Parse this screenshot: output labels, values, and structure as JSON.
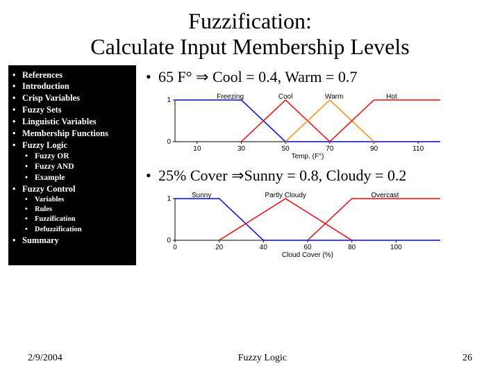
{
  "title_line1": "Fuzzification:",
  "title_line2": "Calculate Input Membership Levels",
  "sidebar": {
    "items": [
      {
        "label": "References"
      },
      {
        "label": "Introduction"
      },
      {
        "label": "Crisp Variables"
      },
      {
        "label": "Fuzzy Sets"
      },
      {
        "label": "Linguistic Variables"
      },
      {
        "label": "Membership Functions"
      },
      {
        "label": "Fuzzy Logic"
      }
    ],
    "sub1": [
      {
        "label": "Fuzzy OR"
      },
      {
        "label": "Fuzzy AND"
      },
      {
        "label": "Example"
      }
    ],
    "fuzzy_control": "Fuzzy Control",
    "sub2": [
      {
        "label": "Variables"
      },
      {
        "label": "Rules"
      },
      {
        "label": "Fuzzification"
      },
      {
        "label": "Defuzzification"
      }
    ],
    "summary": "Summary"
  },
  "main": {
    "bullet_1_pre": "65 F° ",
    "bullet_1_post": " Cool = 0.4, Warm = 0.7",
    "bullet_2_pre": "25% Cover ",
    "bullet_2_post": "Sunny = 0.8, Cloudy = 0.2",
    "arrow": "⇒"
  },
  "footer": {
    "date": "2/9/2004",
    "center": "Fuzzy Logic",
    "page": "26"
  },
  "chart_data": [
    {
      "type": "line",
      "title": "",
      "xlabel": "Temp. (F°)",
      "ylabel": "",
      "xlim": [
        0,
        120
      ],
      "ylim": [
        0,
        1
      ],
      "xticks": [
        10,
        30,
        50,
        70,
        90,
        110
      ],
      "yticks": [
        0,
        1
      ],
      "series": [
        {
          "name": "Freezing",
          "color": "#0000ff",
          "points": [
            [
              0,
              1
            ],
            [
              30,
              1
            ],
            [
              50,
              0
            ],
            [
              120,
              0
            ]
          ]
        },
        {
          "name": "Cool",
          "color": "#ff0000",
          "points": [
            [
              30,
              0
            ],
            [
              50,
              1
            ],
            [
              70,
              0
            ]
          ]
        },
        {
          "name": "Warm",
          "color": "#ff8c00",
          "points": [
            [
              50,
              0
            ],
            [
              70,
              1
            ],
            [
              90,
              0
            ]
          ]
        },
        {
          "name": "Hot",
          "color": "#ff0000",
          "points": [
            [
              70,
              0
            ],
            [
              90,
              1
            ],
            [
              120,
              1
            ]
          ]
        }
      ],
      "label_positions": [
        {
          "name": "Freezing",
          "x": 25
        },
        {
          "name": "Cool",
          "x": 50
        },
        {
          "name": "Warm",
          "x": 72
        },
        {
          "name": "Hot",
          "x": 98
        }
      ]
    },
    {
      "type": "line",
      "title": "",
      "xlabel": "Cloud Cover (%)",
      "ylabel": "",
      "xlim": [
        0,
        120
      ],
      "ylim": [
        0,
        1
      ],
      "xticks": [
        0,
        20,
        40,
        60,
        80,
        100
      ],
      "yticks": [
        0,
        1
      ],
      "series": [
        {
          "name": "Sunny",
          "color": "#0000ff",
          "points": [
            [
              0,
              1
            ],
            [
              20,
              1
            ],
            [
              40,
              0
            ],
            [
              120,
              0
            ]
          ]
        },
        {
          "name": "Partly Cloudy",
          "color": "#ff0000",
          "points": [
            [
              20,
              0
            ],
            [
              50,
              1
            ],
            [
              80,
              0
            ]
          ]
        },
        {
          "name": "Overcast",
          "color": "#ff0000",
          "points": [
            [
              60,
              0
            ],
            [
              80,
              1
            ],
            [
              120,
              1
            ]
          ]
        }
      ],
      "label_positions": [
        {
          "name": "Sunny",
          "x": 12
        },
        {
          "name": "Partly Cloudy",
          "x": 50
        },
        {
          "name": "Overcast",
          "x": 95
        }
      ]
    }
  ]
}
